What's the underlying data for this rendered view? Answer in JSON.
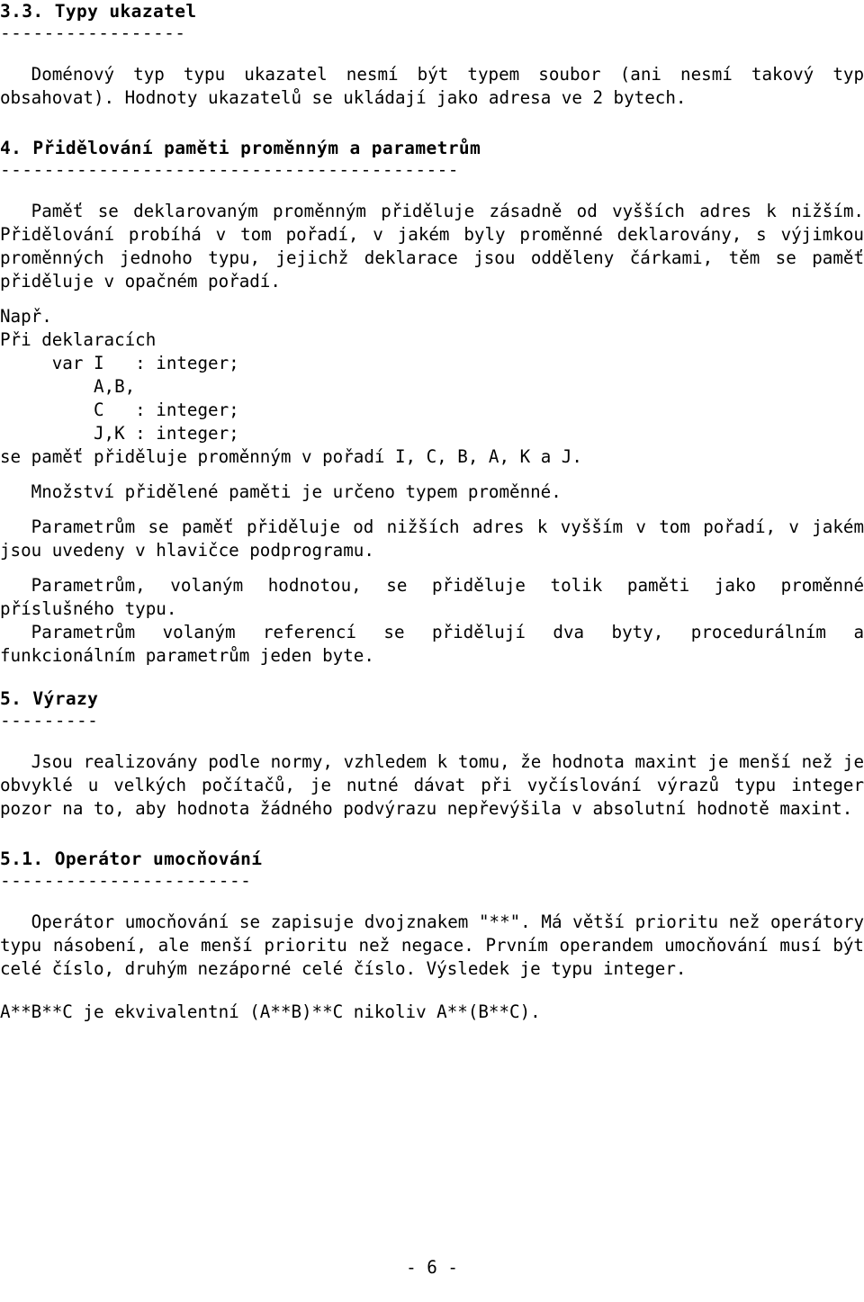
{
  "document": {
    "language": "cs",
    "page_number_label": "- 6 -"
  },
  "sections": {
    "s33": {
      "heading": "3.3. Typy ukazatel",
      "rule": "-----------------",
      "p1": "Doménový typ typu ukazatel nesmí být typem soubor (ani nesmí takový typ obsahovat). Hodnoty ukazatelů se ukládají jako adresa ve 2 bytech."
    },
    "s4": {
      "heading": "4. Přidělování paměti proměnným a parametrům",
      "rule": "------------------------------------------",
      "p1": "Paměť se deklarovaným proměnným přiděluje zásadně od vyšších adres k nižším. Přidělování probíhá v tom pořadí, v jakém byly proměnné deklarovány, s výjimkou proměnných jednoho typu, jejichž deklarace jsou odděleny čárkami, těm se paměť přiděluje v opačném pořadí.",
      "example_intro_1": "Např.",
      "example_intro_2": "Při deklaracích",
      "code_lines": [
        "     var I   : integer;",
        "         A,B,",
        "         C   : integer;",
        "         J,K : integer;"
      ],
      "example_result": "se paměť přiděluje proměnným v pořadí I, C, B, A, K a J.",
      "p2": "Množství přidělené paměti je určeno typem proměnné.",
      "p3": "Parametrům se paměť přiděluje od nižších adres k vyšším v tom pořadí, v jakém jsou uvedeny v hlavičce podprogramu.",
      "p4": "Parametrům, volaným hodnotou, se přiděluje tolik paměti jako proměnné příslušného typu.",
      "p5": "Parametrům volaným referencí se přidělují dva byty, procedurálním a funkcionálním parametrům jeden byte."
    },
    "s5": {
      "heading": "5. Výrazy",
      "rule": "---------",
      "p1": "Jsou realizovány podle normy, vzhledem k tomu, že hodnota maxint je menší než je obvyklé u velkých počítačů, je nutné dávat při vyčíslování výrazů typu integer pozor na to, aby hodnota žádného podvýrazu nepřevýšila v absolutní hodnotě maxint."
    },
    "s51": {
      "heading": "5.1. Operátor umocňování",
      "rule": "-----------------------",
      "p1": "Operátor umocňování se zapisuje dvojznakem \"**\". Má větší prioritu než operátory typu násobení, ale menší prioritu než negace. Prvním operandem umocňování musí být celé číslo, druhým nezáporné celé číslo. Výsledek je typu integer.",
      "p2": "A**B**C je ekvivalentní (A**B)**C nikoliv A**(B**C)."
    }
  }
}
